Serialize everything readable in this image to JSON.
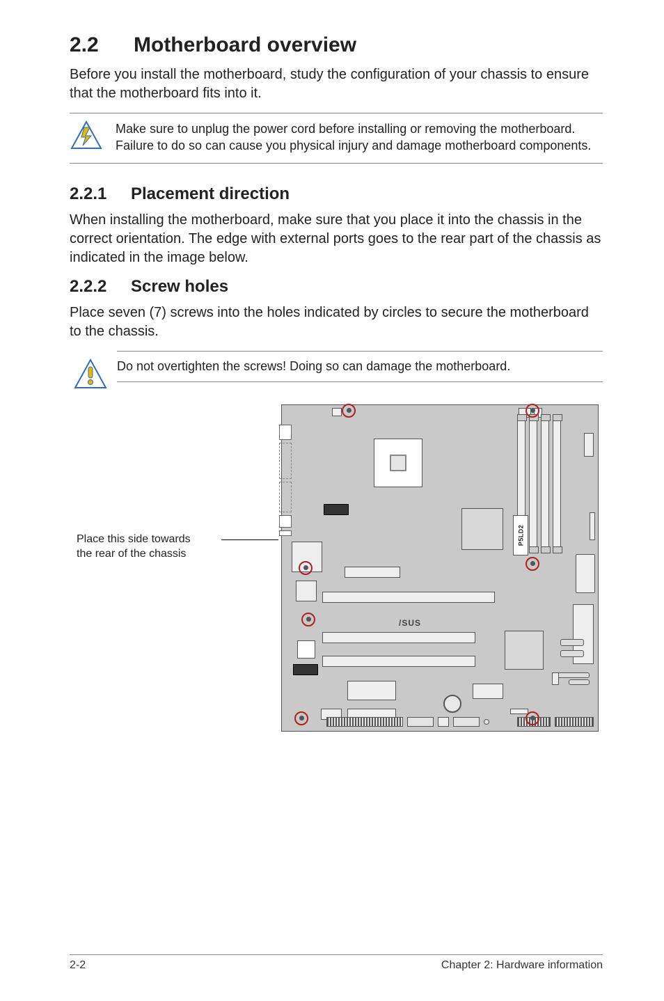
{
  "heading": {
    "number": "2.2",
    "title": "Motherboard overview"
  },
  "intro": "Before you install the motherboard, study the configuration of your chassis to ensure that the motherboard fits into it.",
  "warning_box": "Make sure to unplug the power cord before installing or removing the motherboard. Failure to do so can cause you physical injury and damage motherboard components.",
  "sections": {
    "placement": {
      "number": "2.2.1",
      "title": "Placement direction",
      "body": "When installing the motherboard, make sure that you place it into the chassis in the correct orientation. The edge with external ports goes to the rear part of the chassis as indicated in the image below."
    },
    "screws": {
      "number": "2.2.2",
      "title": "Screw holes",
      "body": "Place seven (7) screws into the holes indicated by circles to secure the motherboard to the chassis."
    }
  },
  "caution_box": "Do not overtighten the screws! Doing so can damage the motherboard.",
  "figure": {
    "side_label_line1": "Place this side towards",
    "side_label_line2": "the rear of the chassis",
    "chip_label": "P5LD2",
    "brand_label": "/SUS"
  },
  "footer": {
    "page": "2-2",
    "chapter": "Chapter 2: Hardware information"
  }
}
